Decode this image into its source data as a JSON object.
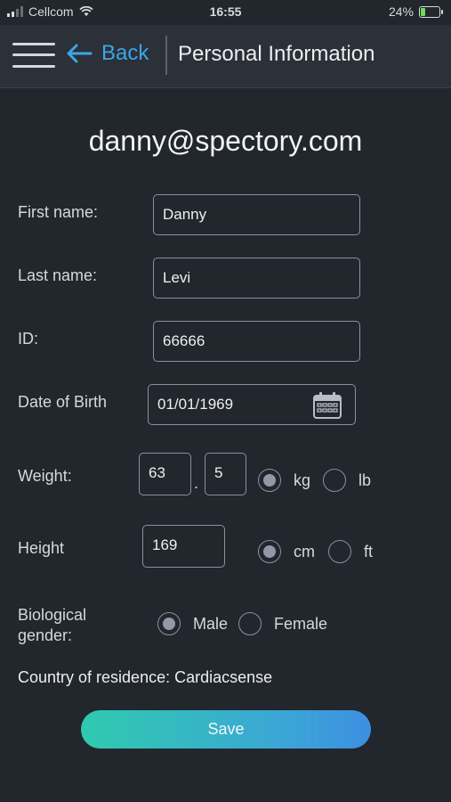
{
  "status": {
    "carrier": "Cellcom",
    "time": "16:55",
    "battery_percent": "24%",
    "battery_level": 0.24
  },
  "header": {
    "back_label": "Back",
    "title": "Personal Information"
  },
  "email": "danny@spectory.com",
  "form": {
    "first_name": {
      "label": "First name:",
      "value": "Danny"
    },
    "last_name": {
      "label": "Last name:",
      "value": "Levi"
    },
    "id": {
      "label": "ID:",
      "value": "66666"
    },
    "dob": {
      "label": "Date of Birth",
      "value": "01/01/1969"
    },
    "weight": {
      "label": "Weight:",
      "whole": "63",
      "decimal": "5",
      "separator": ".",
      "unit_kg": "kg",
      "unit_lb": "lb",
      "selected": "kg"
    },
    "height": {
      "label": "Height",
      "value": "169",
      "unit_cm": "cm",
      "unit_ft": "ft",
      "selected": "cm"
    },
    "gender": {
      "label_line1": "Biological",
      "label_line2": "gender:",
      "male": "Male",
      "female": "Female",
      "selected": "Male"
    },
    "country": "Country of residence: Cardiacsense"
  },
  "save_label": "Save",
  "colors": {
    "accent": "#3ba6e6",
    "background": "#22262d",
    "header": "#2b3039",
    "gradient_start": "#2fcaae",
    "gradient_end": "#3d8fe0"
  }
}
